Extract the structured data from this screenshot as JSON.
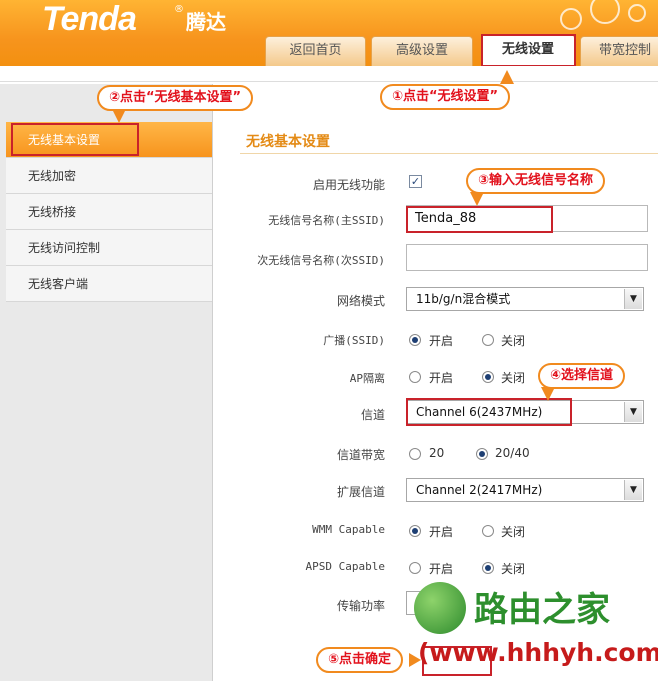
{
  "header": {
    "logo": "Tenda",
    "logo_reg": "®",
    "logo_cn": "腾达",
    "tabs": [
      {
        "label": "返回首页",
        "active": false
      },
      {
        "label": "高级设置",
        "active": false
      },
      {
        "label": "无线设置",
        "active": true
      },
      {
        "label": "带宽控制",
        "active": false
      }
    ]
  },
  "sidebar": {
    "items": [
      {
        "label": "无线基本设置",
        "active": true
      },
      {
        "label": "无线加密",
        "active": false
      },
      {
        "label": "无线桥接",
        "active": false
      },
      {
        "label": "无线访问控制",
        "active": false
      },
      {
        "label": "无线客户端",
        "active": false
      }
    ]
  },
  "main": {
    "title": "无线基本设置",
    "enable_label": "启用无线功能",
    "enable_checked": true,
    "ssid_label": "无线信号名称(主SSID)",
    "ssid_value": "Tenda_88",
    "ssid2_label": "次无线信号名称(次SSID)",
    "ssid2_value": "",
    "mode_label": "网络模式",
    "mode_value": "11b/g/n混合模式",
    "broadcast_label": "广播(SSID)",
    "on_label": "开启",
    "off_label": "关闭",
    "broadcast_value": "on",
    "ap_label": "AP隔离",
    "ap_value": "off",
    "channel_label": "信道",
    "channel_value": "Channel 6(2437MHz)",
    "bandwidth_label": "信道带宽",
    "bw_20": "20",
    "bw_2040": "20/40",
    "bandwidth_value": "20/40",
    "ext_label": "扩展信道",
    "ext_value": "Channel 2(2417MHz)",
    "wmm_label": "WMM Capable",
    "wmm_value": "on",
    "apsd_label": "APSD Capable",
    "apsd_value": "off",
    "power_label": "传输功率"
  },
  "annotations": {
    "step1": "①点击“无线设置”",
    "step2": "②点击“无线基本设置”",
    "step3": "③输入无线信号名称",
    "step4": "④选择信道",
    "step5": "⑤点击确定"
  },
  "watermark": {
    "text": "路由之家",
    "url": "(www.hhhyh.com)"
  },
  "colors": {
    "brand_orange": "#f7941d",
    "annotation_red": "#e2111c",
    "highlight_box": "#c9222a"
  }
}
